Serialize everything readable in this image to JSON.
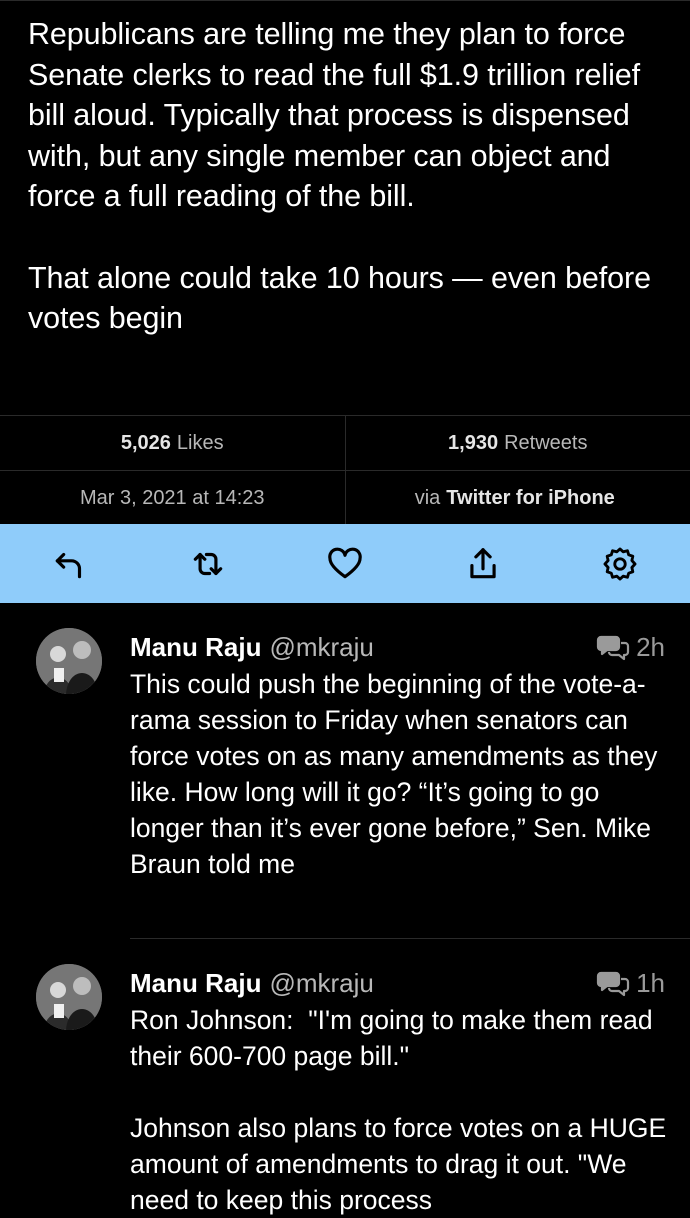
{
  "main_tweet": {
    "text": "Republicans are telling me they plan to force Senate clerks to read the full $1.9 trillion relief bill aloud. Typically that process is dispensed with, but any single member can object and force a full reading of the bill.\n\nThat alone could take 10 hours — even before votes begin"
  },
  "stats": {
    "likes_count": "5,026",
    "likes_label": "Likes",
    "retweets_count": "1,930",
    "retweets_label": "Retweets",
    "date": "Mar 3, 2021 at 14:23",
    "via_label": "via",
    "source": "Twitter for iPhone"
  },
  "toolbar": {
    "background": "#8fccfa",
    "icons": [
      "reply-icon",
      "retweet-icon",
      "like-icon",
      "share-icon",
      "settings-icon"
    ]
  },
  "replies": [
    {
      "name": "Manu Raju",
      "handle": "@mkraju",
      "time": "2h",
      "text": "This could push the beginning of the vote-a-rama session to Friday when senators can force votes on as many amendments as they like. How long will it go? “It’s going to go longer than it’s ever gone before,” Sen. Mike Braun told me"
    },
    {
      "name": "Manu Raju",
      "handle": "@mkraju",
      "time": "1h",
      "text": "Ron Johnson:  \"I'm going to make them read their 600-700 page bill.\"\n\nJohnson also plans to force votes on a HUGE amount of amendments to drag it out. \"We need to keep this process"
    }
  ]
}
